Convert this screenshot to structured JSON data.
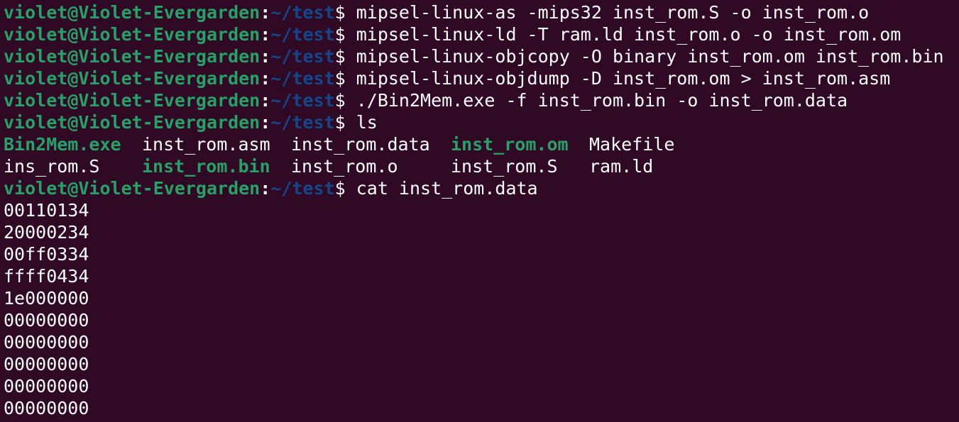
{
  "colors": {
    "background": "#300a24",
    "user": "#26a269",
    "path": "#12488b",
    "text": "#ffffff",
    "executable": "#26a269"
  },
  "prompt": {
    "user_host": "violet@Violet-Evergarden",
    "separator": ":",
    "path": "~/test",
    "symbol": "$"
  },
  "commands": [
    " mipsel-linux-as -mips32 inst_rom.S -o inst_rom.o",
    " mipsel-linux-ld -T ram.ld inst_rom.o -o inst_rom.om",
    " mipsel-linux-objcopy -O binary inst_rom.om inst_rom.bin",
    " mipsel-linux-objdump -D inst_rom.om > inst_rom.asm",
    " ./Bin2Mem.exe -f inst_rom.bin -o inst_rom.data",
    " ls"
  ],
  "ls_output": {
    "row1": [
      "Bin2Mem.exe",
      "inst_rom.asm",
      "inst_rom.data",
      "inst_rom.om",
      "Makefile"
    ],
    "row2": [
      "ins_rom.S",
      "inst_rom.bin",
      "inst_rom.o",
      "inst_rom.S",
      "ram.ld"
    ]
  },
  "last_command": " cat inst_rom.data",
  "cat_output": [
    "00110134",
    "20000234",
    "00ff0334",
    "ffff0434",
    "1e000000",
    "00000000",
    "00000000",
    "00000000",
    "00000000",
    "00000000"
  ]
}
